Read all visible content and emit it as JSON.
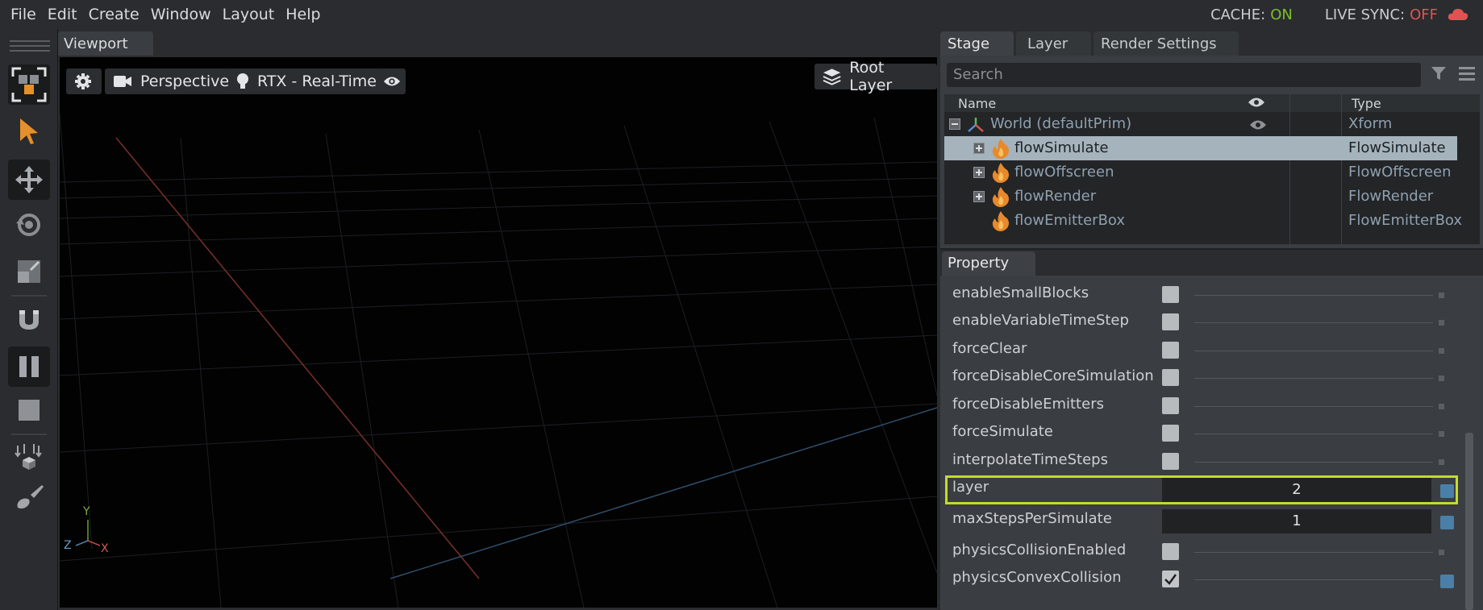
{
  "menu": [
    "File",
    "Edit",
    "Create",
    "Window",
    "Layout",
    "Help"
  ],
  "status": {
    "cache_label": "CACHE:",
    "cache_value": "ON",
    "livesync_label": "LIVE SYNC:",
    "livesync_value": "OFF",
    "colors": {
      "on": "#7bbf2a",
      "off": "#e35252"
    }
  },
  "toolbar": {
    "tools": [
      "select-mode-icon",
      "pointer-icon",
      "move-icon",
      "rotate-icon",
      "scale-icon",
      "snap-magnet-icon",
      "pause-icon",
      "stop-icon",
      "drop-to-floor-icon",
      "paint-brush-icon"
    ]
  },
  "viewport": {
    "tab": "Viewport",
    "camera": "Perspective",
    "renderer": "RTX - Real-Time",
    "layer": "Root Layer",
    "axes": {
      "y": "Y",
      "z": "Z",
      "x": "X"
    }
  },
  "stage": {
    "tabs": [
      "Stage",
      "Layer",
      "Render Settings"
    ],
    "search_placeholder": "Search",
    "columns": {
      "name": "Name",
      "type": "Type"
    },
    "rows": [
      {
        "name": "World (defaultPrim)",
        "type": "Xform"
      },
      {
        "name": "flowSimulate",
        "type": "FlowSimulate"
      },
      {
        "name": "flowOffscreen",
        "type": "FlowOffscreen"
      },
      {
        "name": "flowRender",
        "type": "FlowRender"
      },
      {
        "name": "flowEmitterBox",
        "type": "FlowEmitterBox"
      }
    ]
  },
  "property": {
    "tab": "Property",
    "rows": [
      {
        "label": "enableSmallBlocks",
        "kind": "checkbox",
        "checked": false
      },
      {
        "label": "enableVariableTimeStep",
        "kind": "checkbox",
        "checked": false
      },
      {
        "label": "forceClear",
        "kind": "checkbox",
        "checked": false
      },
      {
        "label": "forceDisableCoreSimulation",
        "kind": "checkbox",
        "checked": false
      },
      {
        "label": "forceDisableEmitters",
        "kind": "checkbox",
        "checked": false
      },
      {
        "label": "forceSimulate",
        "kind": "checkbox",
        "checked": false
      },
      {
        "label": "interpolateTimeSteps",
        "kind": "checkbox",
        "checked": false
      },
      {
        "label": "layer",
        "kind": "number",
        "value": "2"
      },
      {
        "label": "maxStepsPerSimulate",
        "kind": "number",
        "value": "1"
      },
      {
        "label": "physicsCollisionEnabled",
        "kind": "checkbox",
        "checked": false
      },
      {
        "label": "physicsConvexCollision",
        "kind": "checkbox",
        "checked": true
      }
    ]
  }
}
